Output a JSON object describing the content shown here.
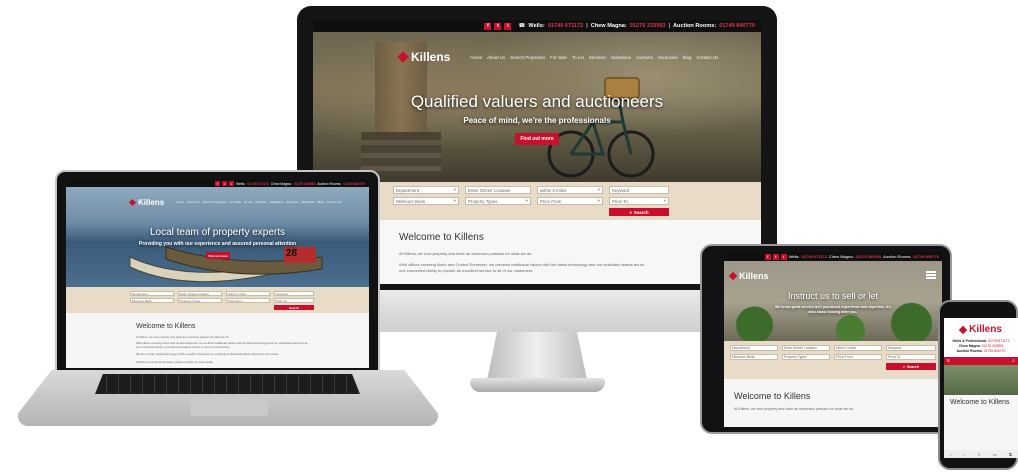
{
  "brand": {
    "name": "Killens",
    "accent": "#c8102e",
    "search_bg": "#e8dcc8"
  },
  "social": [
    "f",
    "t",
    "i"
  ],
  "contact": {
    "wells_label": "Wells:",
    "wells_phone": "01749 671172",
    "chew_label": "Chew Magna:",
    "chew_phone": "01275 333993",
    "auction_label": "Auction Rooms:",
    "auction_phone": "01749 840770"
  },
  "nav": [
    "Home",
    "About Us",
    "Search Properties",
    "For Sale",
    "To Let",
    "Services",
    "Valuations",
    "Auctions",
    "Vacancies",
    "Blog",
    "Contact Us"
  ],
  "desktop": {
    "hero_title": "Qualified valuers and auctioneers",
    "hero_subtitle": "Peace of mind, we're the professionals",
    "hero_button": "Find out more",
    "welcome_title": "Welcome to Killens",
    "welcome_p1": "At Killens, we love property and have an enormous passion for what we do.",
    "welcome_p2": "With offices covering North and Central Somerset, we combine traditional values with the latest technology and our dedicated teams act as one connected family to provide an excellent service to all of our customers."
  },
  "laptop": {
    "hero_title": "Local team of property experts",
    "hero_subtitle": "Providing you with our experience and assured personal attention",
    "hero_button": "Find out more",
    "boat_number": "28",
    "welcome_title": "Welcome to Killens",
    "welcome_p1": "At Killens, we love property and have an enormous passion for what we do.",
    "welcome_p2": "With offices covering North and Central Somerset, we combine traditional values with the latest technology and our dedicated teams act as one connected family to provide an excellent service to all of our customers.",
    "welcome_p3": "We are a local, independent agent with a wealth of experience, providing professional advice tailored to your needs.",
    "welcome_p4": "Whatever your property needs, please contact our team today."
  },
  "tablet": {
    "hero_title": "Instruct us to sell or let",
    "hero_subtitle": "We know great service isn't just about experience and expertise, it's also about looking after you.",
    "welcome_title": "Welcome to Killens",
    "welcome_p1": "At Killens, we love property and have an enormous passion for what we do."
  },
  "phone": {
    "wells_label": "Wells & Professional:",
    "chew_label": "Chew Magna:",
    "auction_label": "Auction Rooms:",
    "welcome_title": "Welcome to Killens"
  },
  "search": {
    "department": "Department",
    "location": "Enter Street/ Location",
    "radius": "within 0 miles",
    "keyword": "Keyword",
    "min_beds": "Minimum Beds",
    "property_types": "Property Types",
    "price_from": "Price From",
    "price_to": "Price To",
    "search_button": "Search"
  }
}
